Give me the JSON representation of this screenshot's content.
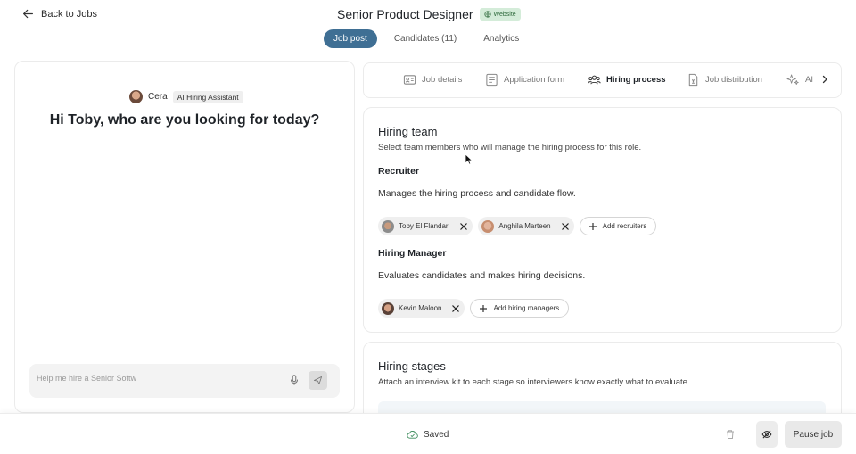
{
  "header": {
    "back_label": "Back to Jobs",
    "job_title": "Senior Product Designer",
    "badge": "Website",
    "tabs": [
      {
        "label": "Job post"
      },
      {
        "label": "Candidates (11)"
      },
      {
        "label": "Analytics"
      }
    ]
  },
  "assistant": {
    "name": "Cera",
    "role": "AI Hiring Assistant",
    "greeting": "Hi Toby, who are you looking for today?",
    "input_placeholder": "Help me hire a Senior Softw"
  },
  "subtabs": [
    {
      "label": "Job details",
      "icon": "id-card-icon"
    },
    {
      "label": "Application form",
      "icon": "form-icon"
    },
    {
      "label": "Hiring process",
      "icon": "team-icon"
    },
    {
      "label": "Job distribution",
      "icon": "document-icon"
    },
    {
      "label": "AI",
      "icon": "sparkle-icon"
    }
  ],
  "hiring_team": {
    "title": "Hiring team",
    "subtitle": "Select team members who will manage the hiring process for this role.",
    "recruiter": {
      "title": "Recruiter",
      "desc": "Manages the hiring process and candidate flow.",
      "members": [
        "Toby El Flandari",
        "Anghila Marteen"
      ],
      "add_label": "Add recruiters"
    },
    "manager": {
      "title": "Hiring Manager",
      "desc": "Evaluates candidates and makes hiring decisions.",
      "members": [
        "Kevin Maloon"
      ],
      "add_label": "Add hiring managers"
    }
  },
  "hiring_stages": {
    "title": "Hiring stages",
    "subtitle": "Attach an interview kit to each stage so interviewers know exactly what to evaluate."
  },
  "footer": {
    "status": "Saved",
    "pause_label": "Pause job"
  },
  "colors": {
    "accent": "#3f6f94",
    "badge_bg": "#d4ecd9",
    "badge_text": "#2f6b3d"
  }
}
